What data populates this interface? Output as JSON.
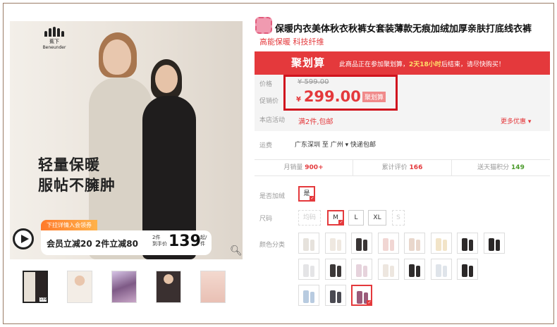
{
  "product": {
    "title": "保暖内衣美体秋衣秋裤女套装薄款无痕加绒加厚亲肤打底线衣裤",
    "subtitle": "高能保暖 科技纤维"
  },
  "gallery": {
    "brand_line1": "蕉下",
    "brand_line2": "Beneunder",
    "slogan_line1": "轻量保暖",
    "slogan_line2": "服帖不臃肿",
    "promo_tag": "下拉详情入会领券",
    "promo_text": "会员立减20 2件立减80",
    "promo_small1": "2件",
    "promo_small2": "到手价",
    "promo_price": "139",
    "promo_unit": "起/件",
    "thumb_tag": "139"
  },
  "banner": {
    "logo": "聚划算",
    "info_prefix": "此商品正在参加聚划算，",
    "info_time": "2天18小时",
    "info_suffix": "后结束，请尽快购买！"
  },
  "price": {
    "label_price": "价格",
    "original": "¥ 599.00",
    "label_promo": "促销价",
    "yen": "¥",
    "current": "299.00",
    "tag": "聚划算",
    "label_activity": "本店活动",
    "activity": "满2件,包邮",
    "more": "更多优惠"
  },
  "shipping": {
    "label": "运费",
    "text": "广东深圳  至 广州 ▾  快递包邮"
  },
  "stats": {
    "sales_label": "月销量",
    "sales_value": "900+",
    "reviews_label": "累计评价",
    "reviews_value": "166",
    "points_label": "送天猫积分",
    "points_value": "149"
  },
  "options": {
    "fleece_label": "是否加绒",
    "fleece_value": "是",
    "size_label": "尺码",
    "sizes": [
      "均码",
      "M",
      "L",
      "XL",
      "S"
    ],
    "color_label": "颜色分类"
  },
  "colors": {
    "accent": "#e4393c",
    "banner": "#e4393c",
    "highlight_border": "#d0141e"
  }
}
